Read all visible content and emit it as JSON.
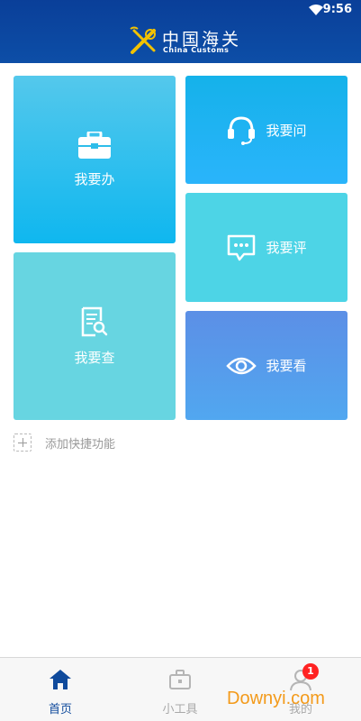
{
  "status_bar": {
    "time": "9:56"
  },
  "header": {
    "logo_cn": "中国海关",
    "logo_en": "China Customs"
  },
  "tiles": [
    {
      "label": "我要办",
      "icon": "briefcase-icon"
    },
    {
      "label": "我要问",
      "icon": "headset-icon"
    },
    {
      "label": "我要评",
      "icon": "chat-bubble-icon"
    },
    {
      "label": "我要查",
      "icon": "document-search-icon"
    },
    {
      "label": "我要看",
      "icon": "eye-icon"
    }
  ],
  "add_shortcut": {
    "label": "添加快捷功能"
  },
  "bottom_nav": {
    "items": [
      {
        "label": "首页",
        "icon": "home-icon",
        "active": true
      },
      {
        "label": "小工具",
        "icon": "toolbox-icon",
        "active": false
      },
      {
        "label": "我的",
        "icon": "user-icon",
        "active": false,
        "badge": "1"
      }
    ]
  },
  "watermark": "Downyi.com",
  "colors": {
    "header": "#0d4ea7",
    "nav_active": "#0f4a9c",
    "badge": "#ff2222",
    "watermark": "#f39a1a"
  }
}
